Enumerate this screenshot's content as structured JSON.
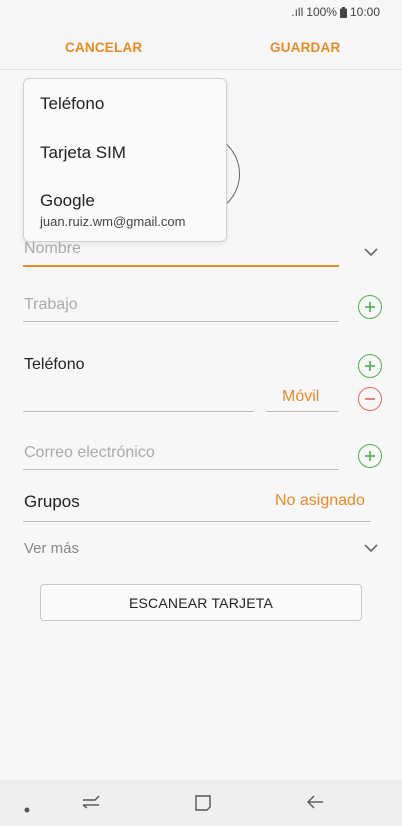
{
  "status": {
    "signal": ".ıll",
    "battery_pct": "100%",
    "time": "10:00"
  },
  "actions": {
    "cancel": "CANCELAR",
    "save": "GUARDAR"
  },
  "dropdown": {
    "items": [
      {
        "label": "Teléfono",
        "selected": true
      },
      {
        "label": "Tarjeta SIM",
        "selected": false
      },
      {
        "label": "Google",
        "selected": false,
        "sub": "juan.ruiz.wm@gmail.com"
      }
    ]
  },
  "form": {
    "name_placeholder": "Nombre",
    "work_placeholder": "Trabajo",
    "phone_label": "Teléfono",
    "phone_type": "Móvil",
    "email_placeholder": "Correo electrónico",
    "groups_label": "Grupos",
    "groups_value": "No asignado",
    "more_label": "Ver más"
  },
  "scan_button": "ESCANEAR TARJETA",
  "colors": {
    "accent": "#e88a26",
    "add": "#4db04d",
    "remove": "#e8665b"
  },
  "nav": {
    "icons": [
      "dot-icon",
      "recent-apps-icon",
      "home-icon",
      "back-icon"
    ]
  }
}
